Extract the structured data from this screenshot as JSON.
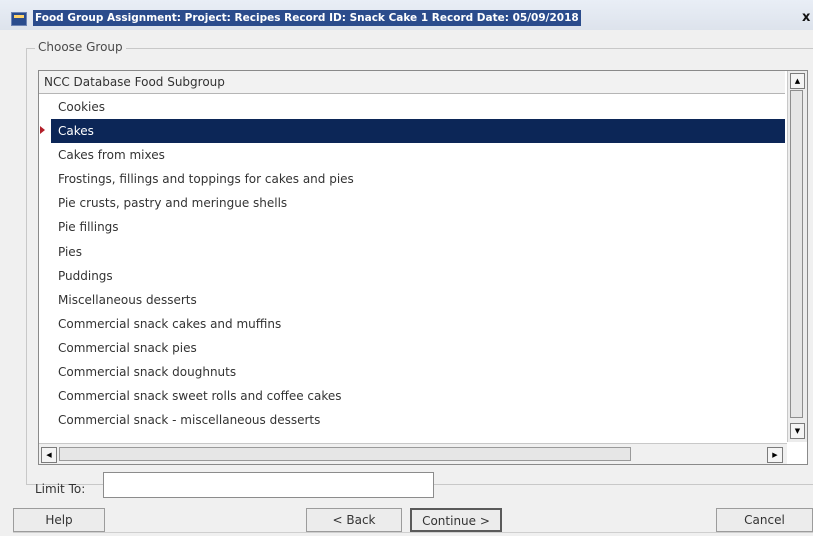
{
  "window": {
    "title": "Food Group Assignment: Project: Recipes Record ID: Snack Cake 1 Record Date: 05/09/2018",
    "close_label": "x"
  },
  "group": {
    "legend": "Choose Group",
    "column_header": "NCC Database Food Subgroup",
    "items": [
      "Cookies",
      "Cakes",
      "Cakes from mixes",
      "Frostings, fillings and toppings for cakes and pies",
      "Pie crusts, pastry and meringue shells",
      "Pie fillings",
      "Pies",
      "Puddings",
      "Miscellaneous desserts",
      "Commercial snack cakes and muffins",
      "Commercial snack pies",
      "Commercial snack doughnuts",
      "Commercial snack sweet rolls and coffee cakes",
      "Commercial snack - miscellaneous desserts"
    ],
    "selected_item": "Cakes"
  },
  "limit": {
    "label": "Limit To:",
    "value": ""
  },
  "buttons": {
    "help": "Help",
    "back": "< Back",
    "continue": "Continue >",
    "cancel": "Cancel"
  },
  "colors": {
    "title_bar_bg": "#2b4c8c",
    "selection_bg": "#0c2657",
    "row_marker": "#b3202a"
  },
  "icons": {
    "app": "app-icon",
    "close": "close-icon",
    "row_marker": "current-row-marker-icon",
    "scroll_up": "scroll-up-arrow-icon",
    "scroll_down": "scroll-down-arrow-icon",
    "scroll_left": "scroll-left-arrow-icon",
    "scroll_right": "scroll-right-arrow-icon"
  }
}
